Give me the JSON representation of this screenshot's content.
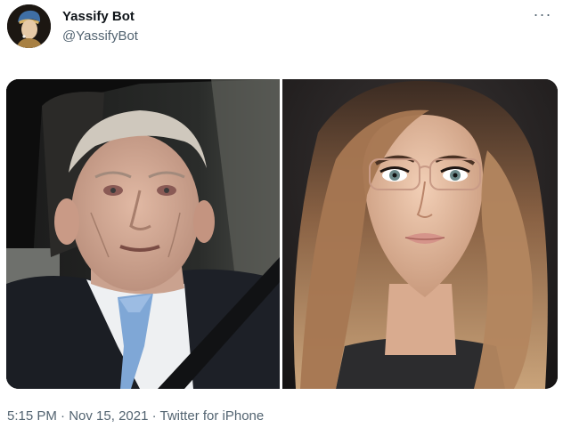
{
  "author": {
    "display_name": "Yassify Bot",
    "handle": "@YassifyBot",
    "avatar_icon": "girl-with-pearl-earring-avatar"
  },
  "more_icon": "more-options-icon",
  "more_label": "···",
  "media": {
    "left_image": "elderly-man-in-car-photo",
    "right_image": "yassified-woman-portrait"
  },
  "meta": {
    "time": "5:15 PM",
    "date": "Nov 15, 2021",
    "source": "Twitter for iPhone",
    "separator": " · "
  },
  "colors": {
    "text_primary": "#0f1419",
    "text_secondary": "#536471",
    "background": "#ffffff"
  }
}
